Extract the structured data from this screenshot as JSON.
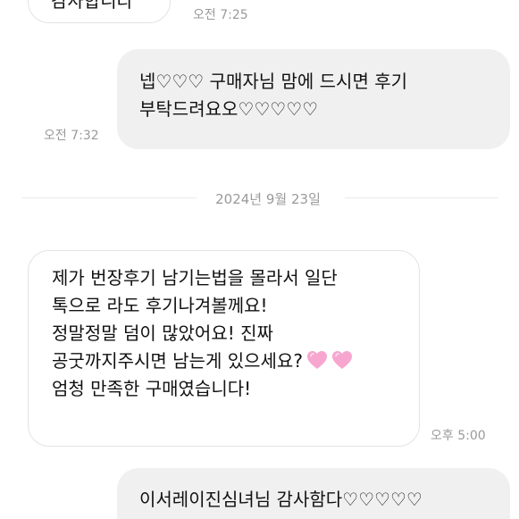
{
  "messages": {
    "m1": {
      "text_line": "감사합니다",
      "time": "오전 7:25"
    },
    "m2": {
      "lines": [
        "넵♡♡♡ 구매자님 맘에 드시면 후기",
        "부탁드려요오♡♡♡♡♡"
      ],
      "time": "오전 7:32"
    },
    "date_separator": "2024년 9월 23일",
    "m3": {
      "lines": [
        "제가 번장후기 남기는법을 몰라서 일단",
        "톡으로 라도 후기나겨볼께요!",
        "정말정말 덤이 많았어요! 진짜",
        "공굿까지주시면 남는게 있으세요?",
        "엄청 만족한 구매였습니다!"
      ],
      "emoji_icon": "pink-heart-icon",
      "emoji_color": "#f7a6cf",
      "time": "오후 5:00"
    },
    "m4": {
      "lines": [
        "이서레이진심녀님 감사함다♡♡♡♡♡"
      ]
    }
  },
  "colors": {
    "incoming_bg": "#ffffff",
    "incoming_border": "#e3e3e3",
    "outgoing_bg": "#f0f0f0",
    "time_text": "#9a9a9a"
  }
}
